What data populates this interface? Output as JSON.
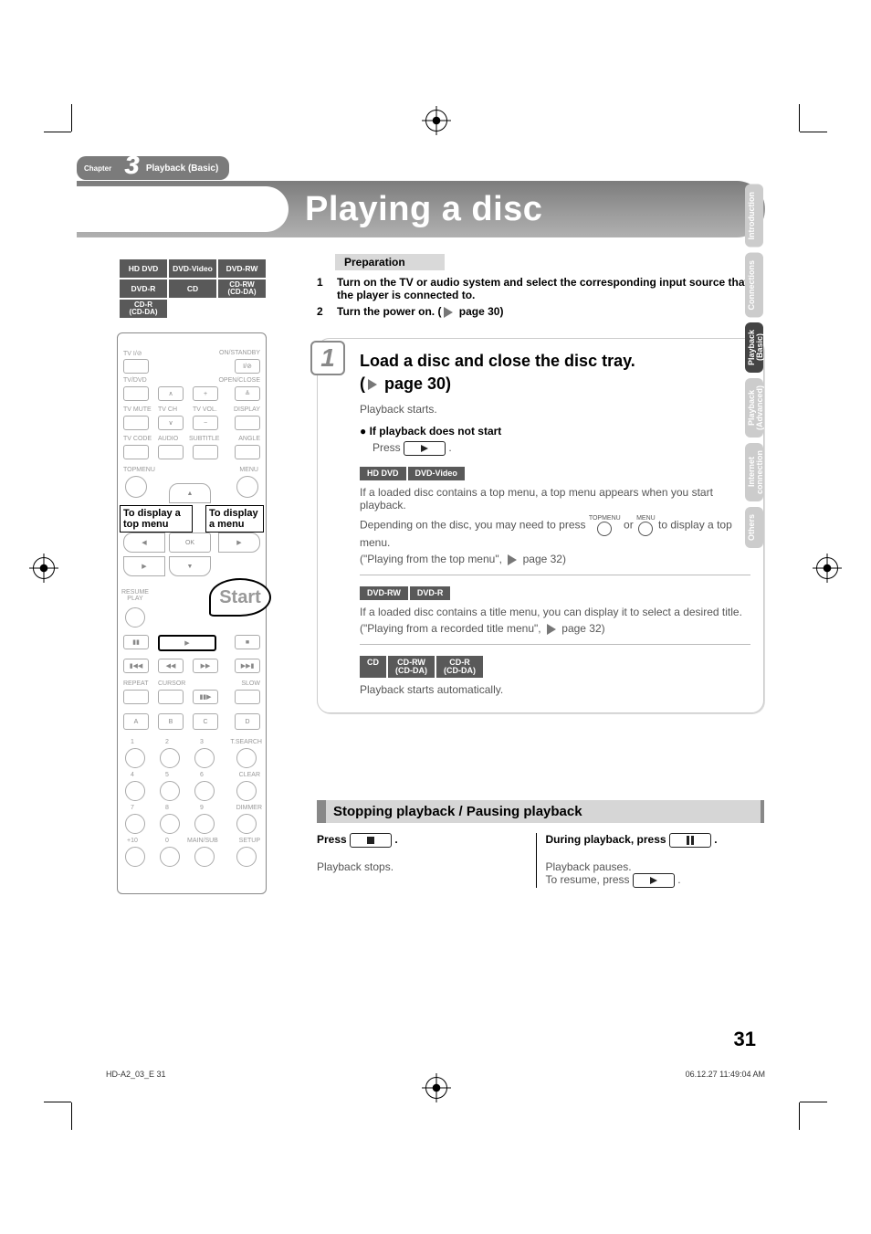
{
  "chapter": {
    "label": "Chapter",
    "number": "3",
    "title": "Playback (Basic)"
  },
  "page_title": "Playing a disc",
  "disc_formats": [
    [
      "HD DVD",
      "DVD-Video",
      "DVD-RW"
    ],
    [
      "DVD-R",
      "CD",
      "CD-RW\n(CD-DA)"
    ],
    [
      "CD-R\n(CD-DA)",
      "",
      ""
    ]
  ],
  "remote": {
    "labels": {
      "tv_power": "TV I/⊘",
      "onstandby": "ON/STANDBY",
      "power_small": "I/⊘",
      "tvdvd": "TV/DVD",
      "openclose": "OPEN/CLOSE",
      "tvmute": "TV MUTE",
      "tvch": "TV CH",
      "tvvol": "TV VOL.",
      "display": "DISPLAY",
      "tvcode": "TV CODE",
      "audio": "AUDIO",
      "subtitle": "SUBTITLE",
      "angle": "ANGLE",
      "topmenu": "TOPMENU",
      "menu": "MENU",
      "ok": "OK",
      "resumeplay": "RESUME\nPLAY",
      "repeat": "REPEAT",
      "cursor": "CURSOR",
      "slow": "SLOW",
      "tsearch": "T.SEARCH",
      "clear": "CLEAR",
      "dimmer": "DIMMER",
      "mainsub": "MAIN/SUB",
      "setup": "SETUP",
      "abcd": {
        "a": "A",
        "b": "B",
        "c": "C",
        "d": "D"
      },
      "numbers": [
        "1",
        "2",
        "3",
        "4",
        "5",
        "6",
        "7",
        "8",
        "9",
        "+10",
        "0"
      ]
    },
    "callout_topmenu": "To display a top menu",
    "callout_menu": "To display a menu",
    "start": "Start"
  },
  "preparation": {
    "heading": "Preparation",
    "items": [
      {
        "n": "1",
        "text": "Turn on the TV or audio system and select the corresponding input source that the player is connected to."
      },
      {
        "n": "2",
        "text_a": "Turn the power on. (",
        "text_b": " page 30)"
      }
    ]
  },
  "step1": {
    "number": "1",
    "title": "Load a disc and close the disc tray.",
    "page_ref_prefix": "(",
    "page_ref": " page 30)",
    "line1": "Playback starts.",
    "nostart_head": "If playback does not start",
    "nostart_text": "Press ",
    "nostart_suffix": " .",
    "tags_a": [
      "HD DVD",
      "DVD-Video"
    ],
    "para_a1": "If a loaded disc contains a top menu, a top menu appears when you start playback.",
    "para_a2a": "Depending on the disc, you may need to press ",
    "para_a2_top": "TOPMENU",
    "para_a2_mid": " or ",
    "para_a2_menu": "MENU",
    "para_a2b": " to display a top menu.",
    "para_a3a": "(\"Playing from the top menu\", ",
    "para_a3b": " page 32)",
    "tags_b": [
      "DVD-RW",
      "DVD-R"
    ],
    "para_b1": "If a loaded disc contains a title menu, you can display it to select a desired title.",
    "para_b2a": "(\"Playing from a recorded title menu\", ",
    "para_b2b": " page 32)",
    "tags_c": [
      "CD",
      "CD-RW\n(CD-DA)",
      "CD-R\n(CD-DA)"
    ],
    "para_c1": "Playback starts automatically."
  },
  "stop_section": {
    "heading": "Stopping playback / Pausing playback",
    "left_head": "Press ",
    "left_suffix": " .",
    "left_body": "Playback stops.",
    "right_head": "During playback, press ",
    "right_suffix": " .",
    "right_body1": "Playback pauses.",
    "right_body2a": "To resume, press ",
    "right_body2b": " ."
  },
  "side_tabs": [
    "Introduction",
    "Connections",
    "Playback\n(Basic)",
    "Playback\n(Advanced)",
    "Internet\nconnection",
    "Others"
  ],
  "page_number": "31",
  "footer_left": "HD-A2_03_E   31",
  "footer_right": "06.12.27   11:49:04 AM"
}
